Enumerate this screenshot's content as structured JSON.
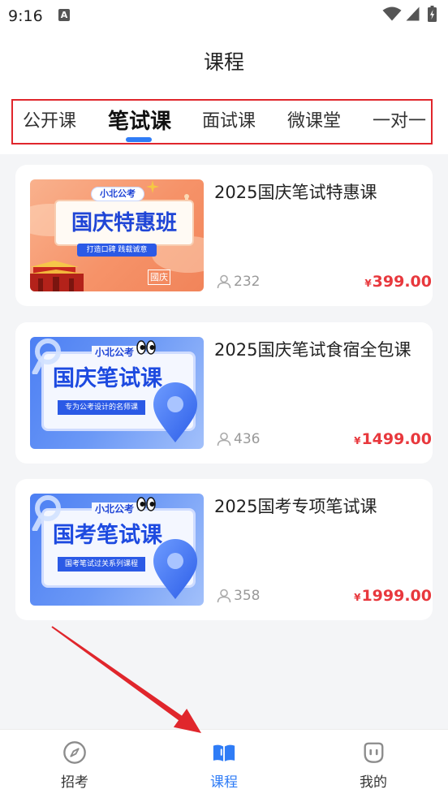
{
  "status_bar": {
    "time": "9:16",
    "notification_glyph": "A",
    "icons": [
      "notification-a-icon",
      "wifi-icon",
      "signal-icon",
      "battery-charging-icon"
    ]
  },
  "header": {
    "title": "课程"
  },
  "tabs": [
    {
      "label": "公开课",
      "active": false
    },
    {
      "label": "笔试课",
      "active": true
    },
    {
      "label": "面试课",
      "active": false
    },
    {
      "label": "微课堂",
      "active": false
    },
    {
      "label": "一对一",
      "active": false
    }
  ],
  "course_card": {
    "students_icon": "person-icon"
  },
  "courses": [
    {
      "title": "2025国庆笔试特惠课",
      "students": "232",
      "currency": "¥",
      "price": "399.00",
      "thumbnail": {
        "brand": "小北公考",
        "headline": "国庆特惠班",
        "tagline": "打造口碑 践载诚意",
        "badge": "國庆"
      }
    },
    {
      "title": "2025国庆笔试食宿全包课",
      "students": "436",
      "currency": "¥",
      "price": "1499.00",
      "thumbnail": {
        "brand": "小北公考",
        "headline": "国庆笔试课",
        "tagline": "专为公考设计的名师课"
      }
    },
    {
      "title": "2025国考专项笔试课",
      "students": "358",
      "currency": "¥",
      "price": "1999.00",
      "thumbnail": {
        "brand": "小北公考",
        "headline": "国考笔试课",
        "tagline": "国考笔试过关系列课程"
      }
    }
  ],
  "bottom_nav": [
    {
      "label": "招考",
      "icon": "compass-icon",
      "active": false
    },
    {
      "label": "课程",
      "icon": "book-open-icon",
      "active": true
    },
    {
      "label": "我的",
      "icon": "face-icon",
      "active": false
    }
  ],
  "colors": {
    "accent": "#2f7cf6",
    "price": "#e8383d",
    "annotation": "#e0262c",
    "background": "#f4f5f7"
  }
}
